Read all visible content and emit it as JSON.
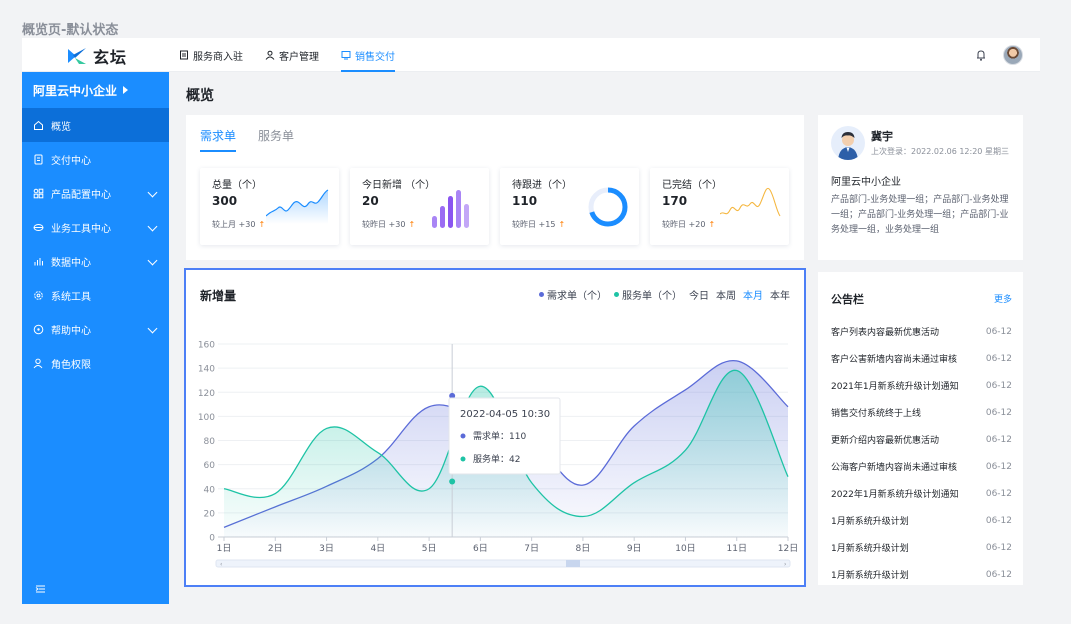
{
  "page_caption": "概览页-默认状态",
  "app": {
    "name": "玄坛"
  },
  "topnav": [
    {
      "label": "服务商入驻",
      "icon": "document-icon",
      "active": false
    },
    {
      "label": "客户管理",
      "icon": "user-icon",
      "active": false
    },
    {
      "label": "销售交付",
      "icon": "delivery-icon",
      "active": true
    }
  ],
  "sidebar": {
    "org": "阿里云中小企业",
    "items": [
      {
        "label": "概览",
        "icon": "home-icon",
        "active": true,
        "expandable": false
      },
      {
        "label": "交付中心",
        "icon": "document-icon",
        "active": false,
        "expandable": false
      },
      {
        "label": "产品配置中心",
        "icon": "grid-icon",
        "active": false,
        "expandable": true
      },
      {
        "label": "业务工具中心",
        "icon": "tool-icon",
        "active": false,
        "expandable": true
      },
      {
        "label": "数据中心",
        "icon": "bar-chart-icon",
        "active": false,
        "expandable": true
      },
      {
        "label": "系统工具",
        "icon": "gear-icon",
        "active": false,
        "expandable": false
      },
      {
        "label": "帮助中心",
        "icon": "help-icon",
        "active": false,
        "expandable": true
      },
      {
        "label": "角色权限",
        "icon": "person-icon",
        "active": false,
        "expandable": false
      }
    ]
  },
  "main": {
    "title": "概览"
  },
  "overview": {
    "tabs": [
      "需求单",
      "服务单"
    ],
    "active_tab": 0,
    "stats": [
      {
        "label": "总量（个）",
        "value": "300",
        "foot": "较上月 +30",
        "chart": "area"
      },
      {
        "label": "今日新增 （个）",
        "value": "20",
        "foot": "较昨日 +30",
        "chart": "bars"
      },
      {
        "label": "待跟进（个）",
        "value": "110",
        "foot": "较昨日 +15",
        "chart": "donut",
        "progress": 0.7
      },
      {
        "label": "已完结（个）",
        "value": "170",
        "foot": "较昨日 +20",
        "chart": "wave"
      }
    ]
  },
  "chart": {
    "title": "新增量",
    "legend": [
      "需求单（个）",
      "服务单（个）"
    ],
    "periods": [
      "今日",
      "本周",
      "本月",
      "本年"
    ],
    "active_period": 2,
    "tooltip": {
      "time": "2022-04-05 10:30",
      "rows": [
        {
          "label": "需求单：110",
          "color": "#5b6bd8"
        },
        {
          "label": "服务单：42",
          "color": "#1ec3a5"
        }
      ]
    },
    "colors": {
      "demand": "#5b6bd8",
      "service": "#1ec3a5"
    }
  },
  "chart_data": {
    "type": "area",
    "categories": [
      "1日",
      "2日",
      "3日",
      "4日",
      "5日",
      "6日",
      "7日",
      "8日",
      "9日",
      "10日",
      "11日",
      "12日"
    ],
    "series": [
      {
        "name": "需求单（个）",
        "values": [
          8,
          25,
          42,
          65,
          108,
          97,
          80,
          43,
          92,
          122,
          146,
          108
        ]
      },
      {
        "name": "服务单（个）",
        "values": [
          40,
          36,
          90,
          70,
          40,
          125,
          45,
          17,
          45,
          72,
          138,
          50
        ]
      }
    ],
    "ylim": [
      0,
      160
    ],
    "yticks": [
      0,
      20,
      40,
      60,
      80,
      100,
      120,
      140,
      160
    ],
    "grid": true
  },
  "user": {
    "name": "冀宇",
    "last_login": "上次登录：2022.02.06 12:20 星期三",
    "org": "阿里云中小企业",
    "dept": "产品部门-业务处理一组；产品部门-业务处理一组；产品部门-业务处理一组；产品部门-业务处理一组，业务处理一组"
  },
  "notice": {
    "title": "公告栏",
    "more": "更多",
    "items": [
      {
        "title": "客户列表内容最新优惠活动",
        "date": "06-12"
      },
      {
        "title": "客户公害新墙内容尚未通过审核",
        "date": "06-12"
      },
      {
        "title": "2021年1月新系统升级计划通知",
        "date": "06-12"
      },
      {
        "title": "销售交付系统终于上线",
        "date": "06-12"
      },
      {
        "title": "更新介绍内容最新优惠活动",
        "date": "06-12"
      },
      {
        "title": "公海客户新墙内容尚未通过审核",
        "date": "06-12"
      },
      {
        "title": "2022年1月新系统升级计划通知",
        "date": "06-12"
      },
      {
        "title": "1月新系统升级计划",
        "date": "06-12"
      },
      {
        "title": "1月新系统升级计划",
        "date": "06-12"
      },
      {
        "title": "1月新系统升级计划",
        "date": "06-12"
      }
    ]
  }
}
